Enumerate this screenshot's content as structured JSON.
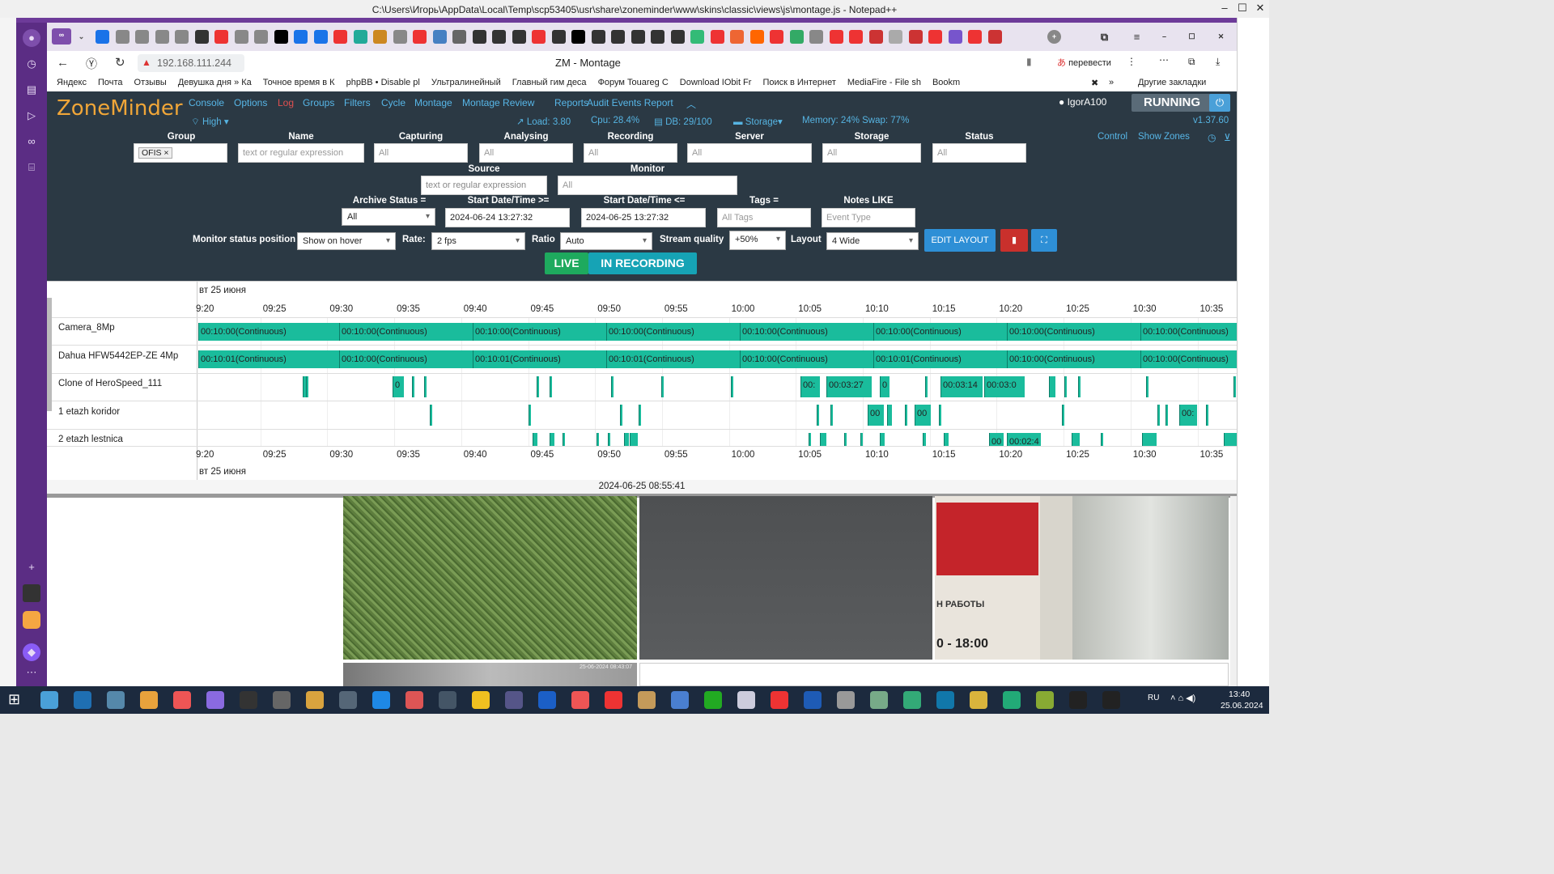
{
  "notepad": {
    "title": "C:\\Users\\Игорь\\AppData\\Local\\Temp\\scp53405\\usr\\share\\zoneminder\\www\\skins\\classic\\views\\js\\montage.js - Notepad++"
  },
  "browser": {
    "address": "192.168.111.244",
    "page_title": "ZM - Montage",
    "translate_label": "перевести",
    "bookmarks": [
      "Яндекс",
      "Почта",
      "Отзывы",
      "Девушка дня » Ка",
      "Точное время в К",
      "phpBB • Disable pl",
      "Ультралинейный",
      "Главный гим деса",
      "Форум Touareg C",
      "Download IObit Fr",
      "Поиск в Интернет",
      "MediaFire - File sh",
      "Bookm"
    ],
    "other_bookmarks": "Другие закладки"
  },
  "zm": {
    "logo": "ZoneMinder",
    "nav": [
      "Console",
      "Options",
      "Log",
      "Groups",
      "Filters",
      "Cycle",
      "Montage",
      "Montage Review",
      "Reports",
      "Audit Events Report"
    ],
    "user": "IgorA100",
    "state": "RUNNING",
    "bandwidth": "High",
    "load": "Load: 3.80",
    "cpu": "Cpu: 28.4%",
    "db": "DB: 29/100",
    "storage": "Storage",
    "memory": "Memory: 24% Swap: 77%",
    "version": "v1.37.60",
    "links": {
      "control": "Control",
      "show_zones": "Show Zones"
    },
    "filters": {
      "group_label": "Group",
      "group_value": "OFIS",
      "name_label": "Name",
      "name_placeholder": "text or regular expression",
      "capturing_label": "Capturing",
      "analysing_label": "Analysing",
      "recording_label": "Recording",
      "server_label": "Server",
      "storage_label": "Storage",
      "status_label": "Status",
      "all": "All",
      "source_label": "Source",
      "source_placeholder": "text or regular expression",
      "monitor_label": "Monitor",
      "archive_label": "Archive Status  =",
      "archive_value": "All",
      "start_ge_label": "Start Date/Time  >=",
      "start_ge_value": "2024-06-24 13:27:32",
      "start_le_label": "Start Date/Time  <=",
      "start_le_value": "2024-06-25 13:27:32",
      "tags_label": "Tags  =",
      "tags_placeholder": "All Tags",
      "notes_label": "Notes  LIKE",
      "notes_placeholder": "Event Type"
    },
    "controls": {
      "status_pos_label": "Monitor status position",
      "status_pos_value": "Show on hover",
      "rate_label": "Rate:",
      "rate_value": "2 fps",
      "ratio_label": "Ratio",
      "ratio_value": "Auto",
      "quality_label": "Stream quality",
      "quality_value": "+50%",
      "layout_label": "Layout",
      "layout_value": "4 Wide",
      "edit_layout": "EDIT LAYOUT",
      "live": "LIVE",
      "in_recording": "IN RECORDING"
    }
  },
  "timeline": {
    "date": "вт 25 июня",
    "ticks": [
      "9:20",
      "09:25",
      "09:30",
      "09:35",
      "09:40",
      "09:45",
      "09:50",
      "09:55",
      "10:00",
      "10:05",
      "10:10",
      "10:15",
      "10:20",
      "10:25",
      "10:30",
      "10:35"
    ],
    "monitors": [
      "Camera_8Mp",
      "Dahua HFW5442EP-ZE 4Mp",
      "Clone of HeroSpeed_111",
      "1 etazh koridor",
      "2 etazh lestnica"
    ],
    "row1": [
      "00:10:00(Continuous)",
      "00:10:00(Continuous)",
      "00:10:00(Continuous)",
      "00:10:00(Continuous)",
      "00:10:00(Continuous)",
      "00:10:00(Continuous)",
      "00:10:00(Continuous)",
      "00:10:00(Continuous)"
    ],
    "row2": [
      "00:10:01(Continuous)",
      "00:10:00(Continuous)",
      "00:10:01(Continuous)",
      "00:10:01(Continuous)",
      "00:10:00(Continuous)",
      "00:10:01(Continuous)",
      "00:10:00(Continuous)",
      "00:10:00(Continuous)"
    ],
    "row3_labels": [
      "0",
      "00:",
      "00:03:27",
      "0",
      "00:03:14",
      "00:03:0"
    ],
    "row4_labels": [
      "00",
      "00",
      "00:"
    ],
    "row5_labels": [
      "00",
      "00:02:4"
    ]
  },
  "video": {
    "timestamp": "2024-06-25 08:55:41",
    "cam_text1": "Н РАБОТЫ",
    "cam_text2": "0 - 18:00",
    "overlay_ts": "25-06-2024 08:43:07"
  },
  "taskbar": {
    "lang": "RU",
    "time": "13:40",
    "date": "25.06.2024"
  }
}
